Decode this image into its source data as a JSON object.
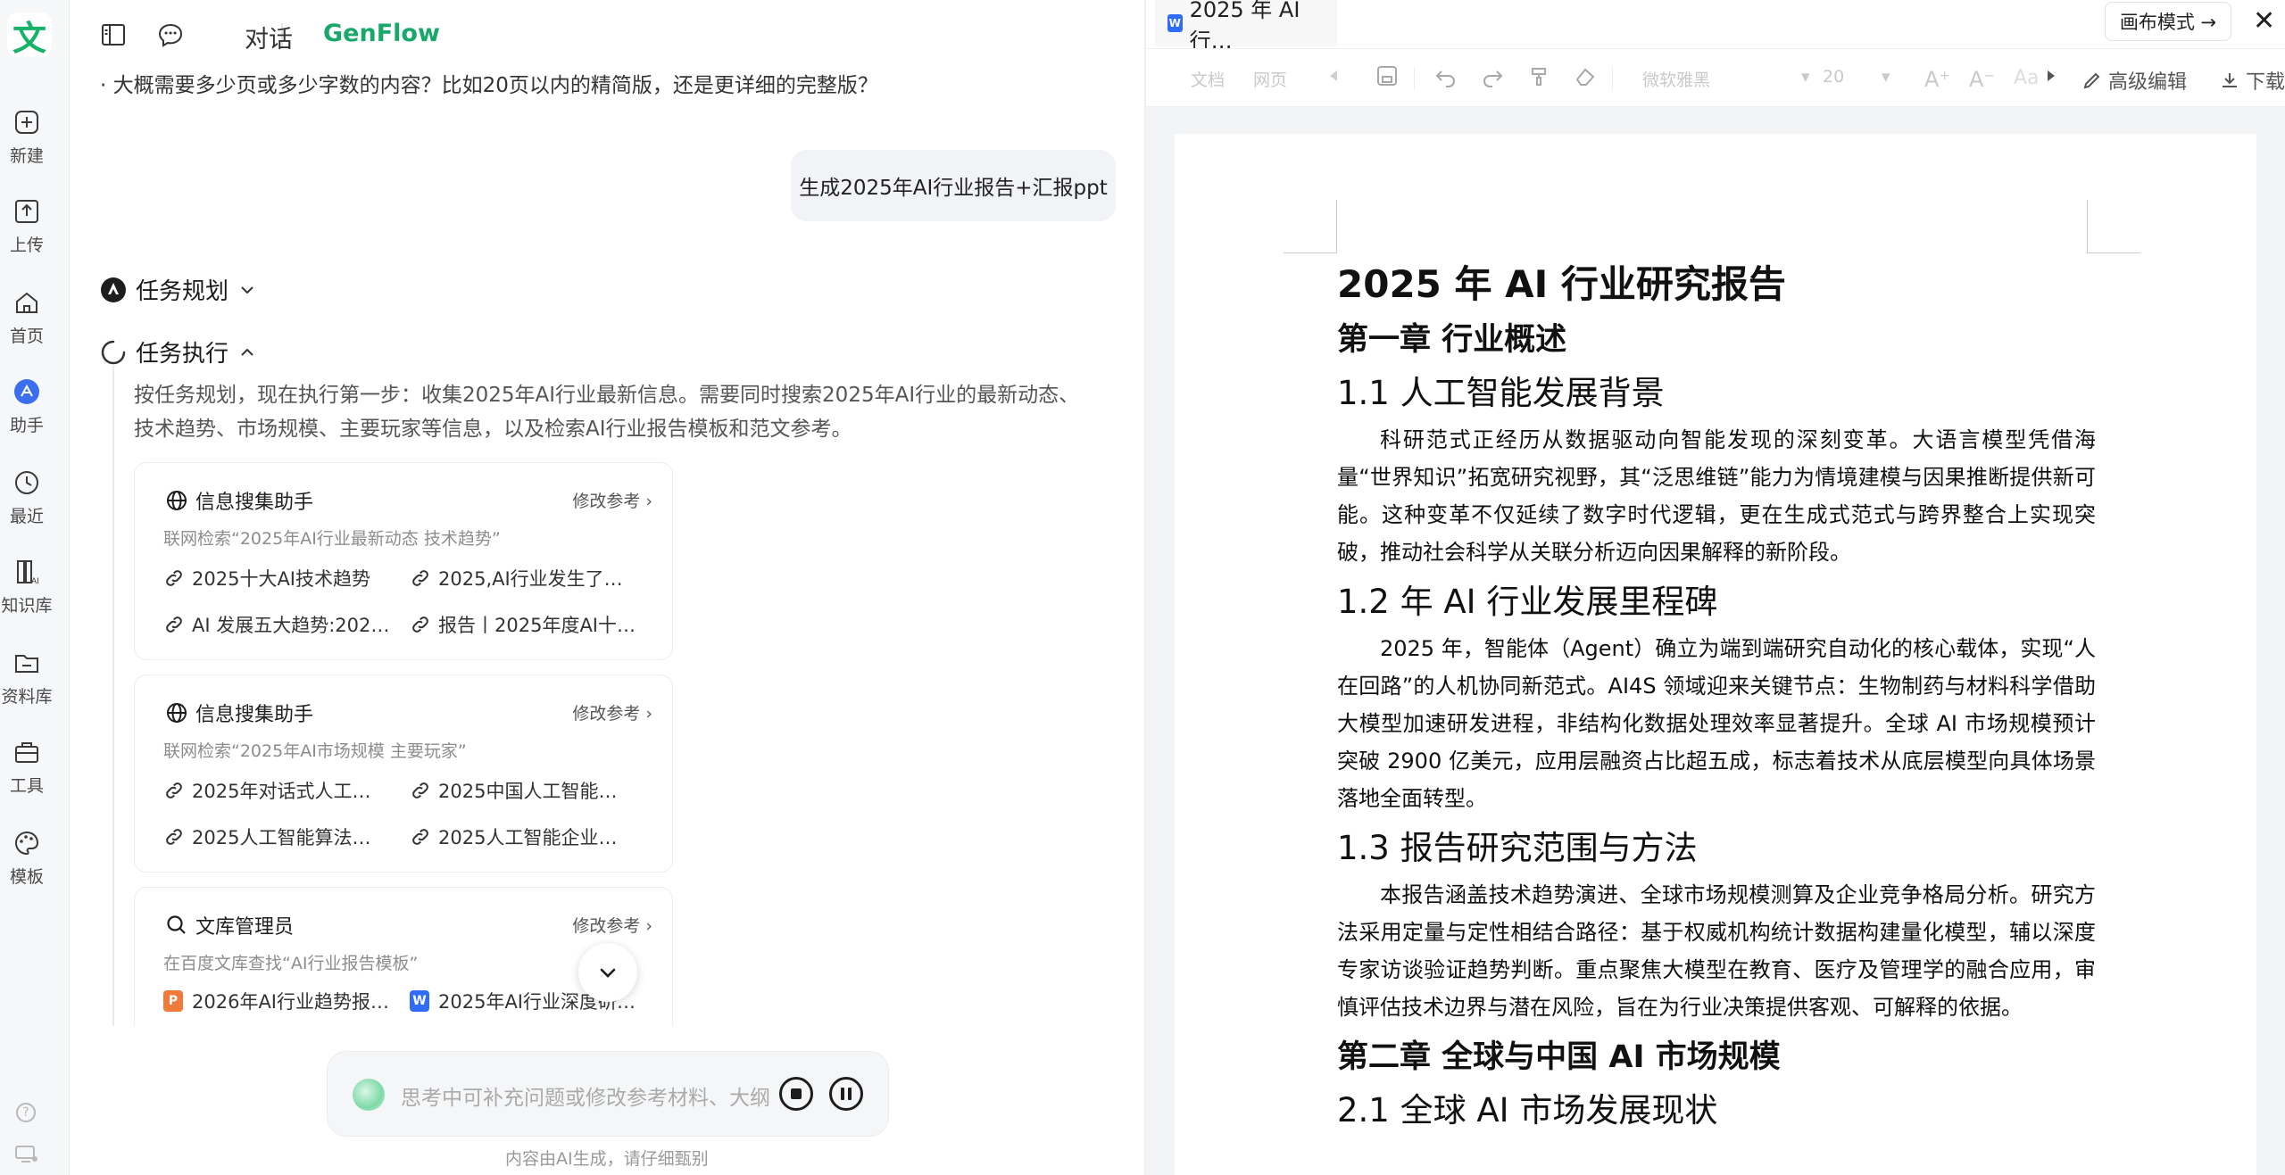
{
  "rail": {
    "logo": "文",
    "items": [
      {
        "label": "新建",
        "icon": "plus-icon"
      },
      {
        "label": "上传",
        "icon": "upload-icon"
      },
      {
        "label": "首页",
        "icon": "home-icon"
      },
      {
        "label": "助手",
        "icon": "assistant-icon"
      },
      {
        "label": "最近",
        "icon": "clock-icon"
      },
      {
        "label": "知识库",
        "icon": "knowledge-icon"
      },
      {
        "label": "资料库",
        "icon": "folder-icon"
      },
      {
        "label": "工具",
        "icon": "toolbox-icon"
      },
      {
        "label": "模板",
        "icon": "palette-icon"
      }
    ],
    "help": "?"
  },
  "topbar": {
    "tab_chat": "对话",
    "tab_genflow": "GenFlow",
    "accent": "#17a86a"
  },
  "chat": {
    "prev_line": "· 大概需要多少页或多少字数的内容？比如20页以内的精简版，还是更详细的完整版？",
    "user_message": "生成2025年AI行业报告+汇报ppt",
    "plan_title": "任务规划",
    "exec_title": "任务执行",
    "exec_desc": "按任务规划，现在执行第一步：收集2025年AI行业最新信息。需要同时搜索2025年AI行业的最新动态、技术趋势、市场规模、主要玩家等信息，以及检索AI行业报告模板和范文参考。",
    "cards": [
      {
        "title": "信息搜集助手",
        "edit": "修改参考",
        "sub": "联网检索“2025年AI行业最新动态 技术趋势”",
        "refs": [
          "2025十大AI技术趋势",
          "2025,AI行业发生了…",
          "AI 发展五大趋势:202…",
          "报告丨2025年度AI十…"
        ]
      },
      {
        "title": "信息搜集助手",
        "edit": "修改参考",
        "sub": "联网检索“2025年AI市场规模 主要玩家”",
        "refs": [
          "2025年对话式人工…",
          "2025中国人工智能…",
          "2025人工智能算法…",
          "2025人工智能企业…"
        ]
      },
      {
        "title": "文库管理员",
        "edit": "修改参考",
        "sub": "在百度文库查找“AI行业报告模板”",
        "refs": [
          "2026年AI行业趋势报…",
          "2025年AI行业深度研…"
        ]
      }
    ],
    "composer_placeholder": "思考中可补充问题或修改参考材料、大纲",
    "footnote": "内容由AI生成，请仔细甄别"
  },
  "doc": {
    "tab_title": "2025 年 AI 行…",
    "canvas_mode": "画布模式 →",
    "toolbar": {
      "doc": "文档",
      "web": "网页",
      "font": "微软雅黑",
      "size": "20",
      "advanced_edit": "高级编辑",
      "download": "下载"
    },
    "title": "2025 年 AI 行业研究报告",
    "ch1": "第一章 行业概述",
    "s11": "1.1 人工智能发展背景",
    "p11": "科研范式正经历从数据驱动向智能发现的深刻变革。大语言模型凭借海量“世界知识”拓宽研究视野，其“泛思维链”能力为情境建模与因果推断提供新可能。这种变革不仅延续了数字时代逻辑，更在生成式范式与跨界整合上实现突破，推动社会科学从关联分析迈向因果解释的新阶段。",
    "s12": "1.2 年 AI 行业发展里程碑",
    "p12": "2025 年，智能体（Agent）确立为端到端研究自动化的核心载体，实现“人在回路”的人机协同新范式。AI4S 领域迎来关键节点：生物制药与材料科学借助大模型加速研发进程，非结构化数据处理效率显著提升。全球 AI 市场规模预计突破 2900 亿美元，应用层融资占比超五成，标志着技术从底层模型向具体场景落地全面转型。",
    "s13": "1.3 报告研究范围与方法",
    "p13": "本报告涵盖技术趋势演进、全球市场规模测算及企业竞争格局分析。研究方法采用定量与定性相结合路径：基于权威机构统计数据构建量化模型，辅以深度专家访谈验证趋势判断。重点聚焦大模型在教育、医疗及管理学的融合应用，审慎评估技术边界与潜在风险，旨在为行业决策提供客观、可解释的依据。",
    "ch2": "第二章 全球与中国 AI 市场规模",
    "s21": "2.1 全球 AI 市场发展现状"
  }
}
